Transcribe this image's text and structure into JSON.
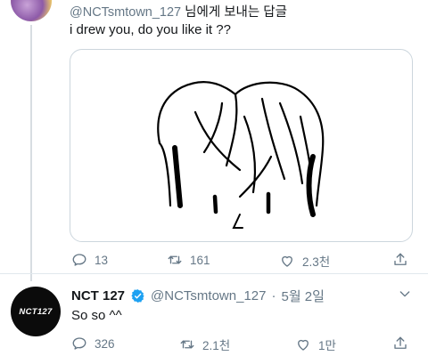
{
  "reply_tweet": {
    "replying_to_handle": "@NCTsmtown_127",
    "replying_to_suffix": " 님에게 보내는 답글",
    "text": "i drew you, do you like it ??",
    "actions": {
      "reply_count": "13",
      "retweet_count": "161",
      "like_count": "2.3천"
    }
  },
  "response_tweet": {
    "display_name": "NCT 127",
    "handle": "@NCTsmtown_127",
    "separator": "·",
    "date": "5월 2일",
    "text": "So so ^^",
    "avatar_logo_text": "NCT127",
    "actions": {
      "reply_count": "326",
      "retweet_count": "2.1천",
      "like_count": "1만"
    }
  },
  "icons": [
    "reply-icon",
    "retweet-icon",
    "like-icon",
    "share-icon",
    "verified-badge-icon",
    "chevron-down-icon"
  ],
  "colors": {
    "muted": "#657786",
    "text": "#14171a",
    "verified": "#1da1f2",
    "border": "#ccd6dd"
  }
}
